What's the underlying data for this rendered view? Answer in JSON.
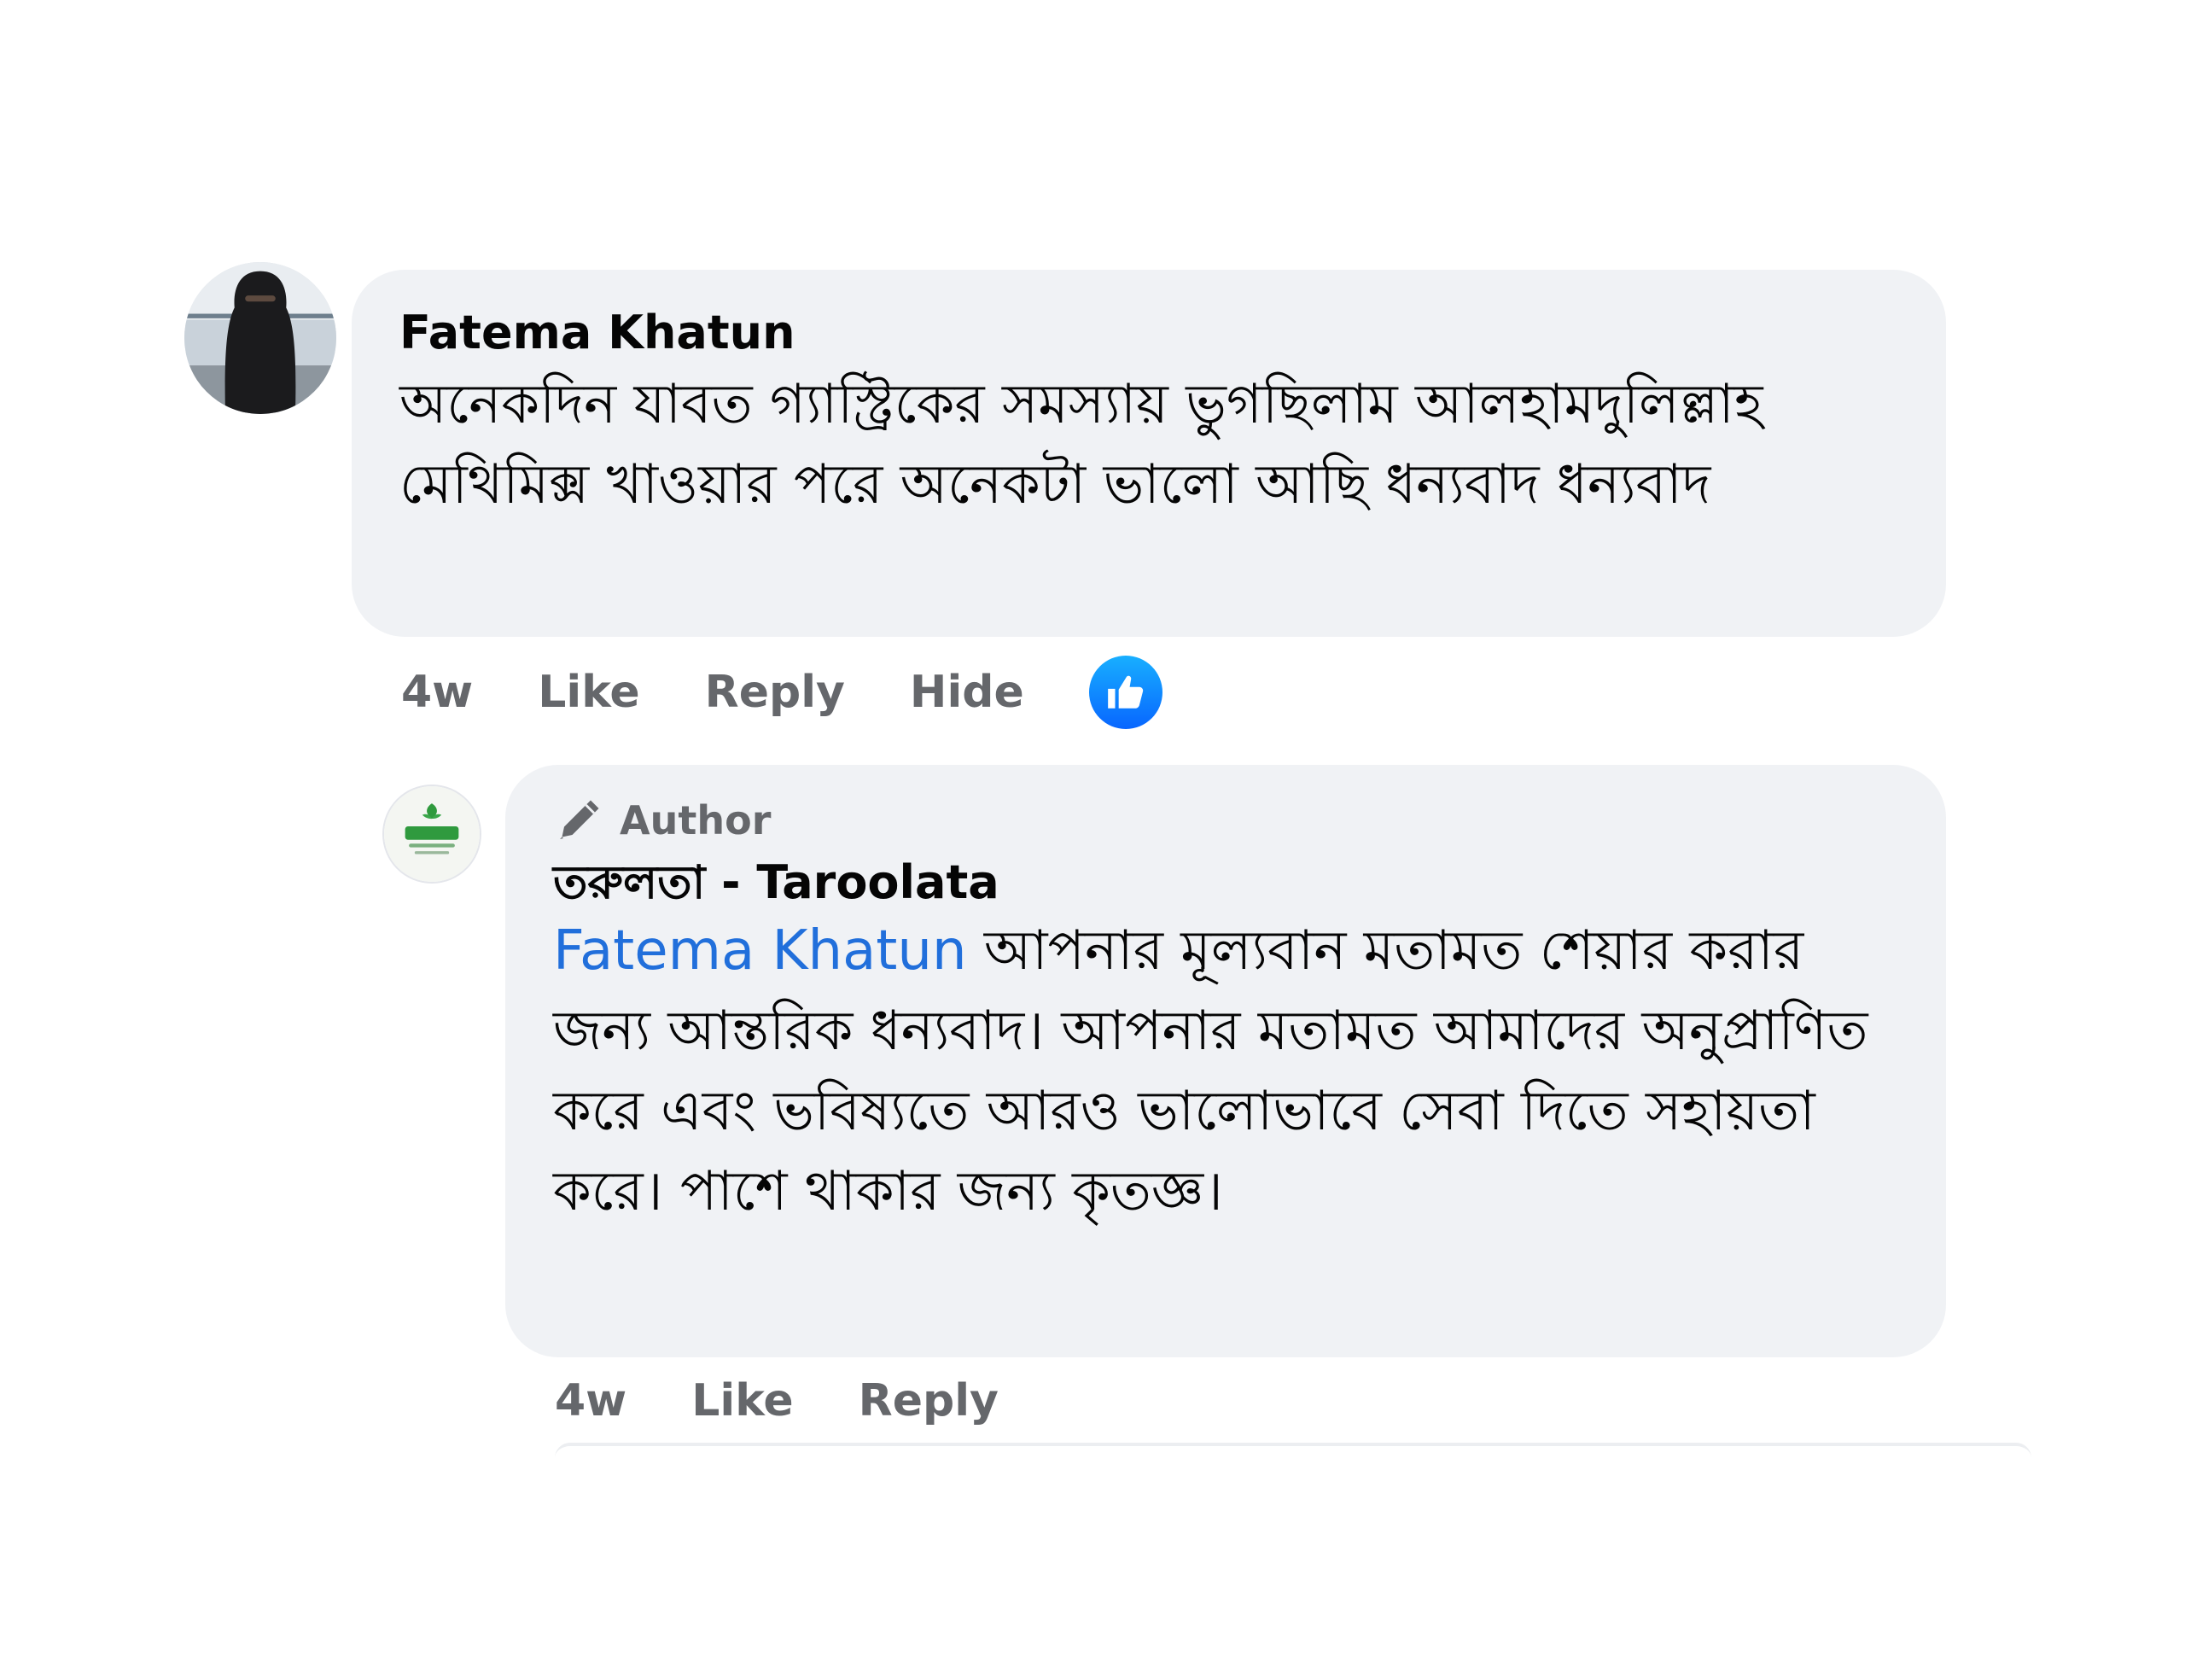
{
  "comment": {
    "author": "Fatema Khatun",
    "text": "অনেকদিন যাবত গ্যাস্ট্রিকের সমস্যায় ভুগছিলাম আলহামদুলিল্লাহ মেথিমিক্স খাওয়ার পরে অনেকটা ভালো আছি ধন্যবাদ ধন্যবাদ",
    "time": "4w",
    "like_label": "Like",
    "reply_label": "Reply",
    "hide_label": "Hide",
    "reaction_icon": "like-reaction-icon",
    "reaction_color": "#0866ff"
  },
  "reply": {
    "badge": "Author",
    "author": "তরুলতা - Taroolata",
    "mention": "Fatema Khatun",
    "text": "আপনার মূল্যবান মতামত শেয়ার করার জন্য আন্তরিক ধন্যবাদ। আপনার মতামত আমাদের অনুপ্রাণিত করে এবং ভবিষ্যতে আরও ভালোভাবে সেবা দিতে সহায়তা করে। পাশে থাকার জন্য কৃতজ্ঞ।",
    "time": "4w",
    "like_label": "Like",
    "reply_label": "Reply",
    "mention_color": "#216fdb"
  },
  "colors": {
    "bubble_bg": "#f0f2f5",
    "meta_text": "#65676b",
    "body_text": "#050505"
  }
}
